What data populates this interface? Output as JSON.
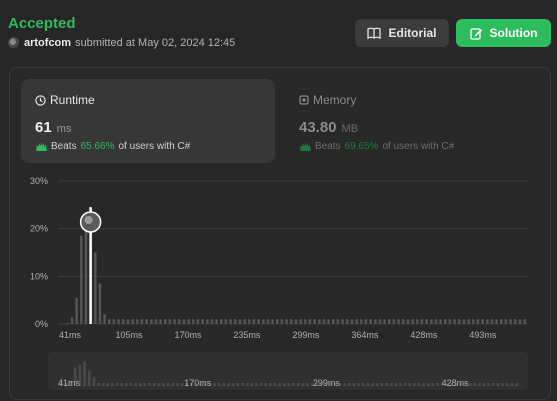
{
  "header": {
    "status": "Accepted",
    "username": "artofcom",
    "submitted_text": "submitted at May 02, 2024 12:45",
    "editorial_label": "Editorial",
    "solution_label": "Solution"
  },
  "runtime": {
    "title": "Runtime",
    "value": "61",
    "unit": "ms",
    "beats_label": "Beats",
    "beats_pct": "65.66%",
    "beats_suffix": "of users with C#"
  },
  "memory": {
    "title": "Memory",
    "value": "43.80",
    "unit": "MB",
    "beats_label": "Beats",
    "beats_pct": "69.65%",
    "beats_suffix": "of users with C#"
  },
  "colors": {
    "accent": "#2cbb5d",
    "bar": "#555555",
    "highlight": "#ffffff"
  },
  "chart_data": {
    "type": "bar",
    "ylabels": [
      "30%",
      "20%",
      "10%",
      "0%"
    ],
    "xlabels": [
      "41ms",
      "105ms",
      "170ms",
      "235ms",
      "299ms",
      "364ms",
      "428ms",
      "493ms"
    ],
    "mini_xlabels": [
      "41ms",
      "170ms",
      "299ms",
      "428ms"
    ],
    "ylim": [
      0,
      30
    ],
    "values": [
      0.2,
      1.5,
      5.5,
      18.5,
      21.5,
      24.5,
      15.0,
      8.5,
      2.0,
      1.0,
      1.0,
      1.0,
      1.0,
      1.0,
      1.0,
      1.0,
      1.0,
      1.0,
      1.0,
      1.0,
      1.0,
      1.0,
      1.0,
      1.0,
      1.0,
      1.0,
      1.0,
      1.0,
      1.0,
      1.0,
      1.0,
      1.0,
      1.0,
      1.0,
      1.0,
      1.0,
      1.0,
      1.0,
      1.0,
      1.0,
      1.0,
      1.0,
      1.0,
      1.0,
      1.0,
      1.0,
      1.0,
      1.0,
      1.0,
      1.0,
      1.0,
      1.0,
      1.0,
      1.0,
      1.0,
      1.0,
      1.0,
      1.0,
      1.0,
      1.0,
      1.0,
      1.0,
      1.0,
      1.0,
      1.0,
      1.0,
      1.0,
      1.0,
      1.0,
      1.0,
      1.0,
      1.0,
      1.0,
      1.0,
      1.0,
      1.0,
      1.0,
      1.0,
      1.0,
      1.0,
      1.0,
      1.0,
      1.0,
      1.0,
      1.0,
      1.0,
      1.0,
      1.0,
      1.0,
      1.0,
      1.0,
      1.0,
      1.0,
      1.0,
      1.0,
      1.0,
      1.0,
      1.0,
      1.0
    ],
    "highlight_index": 5,
    "grid": true
  }
}
